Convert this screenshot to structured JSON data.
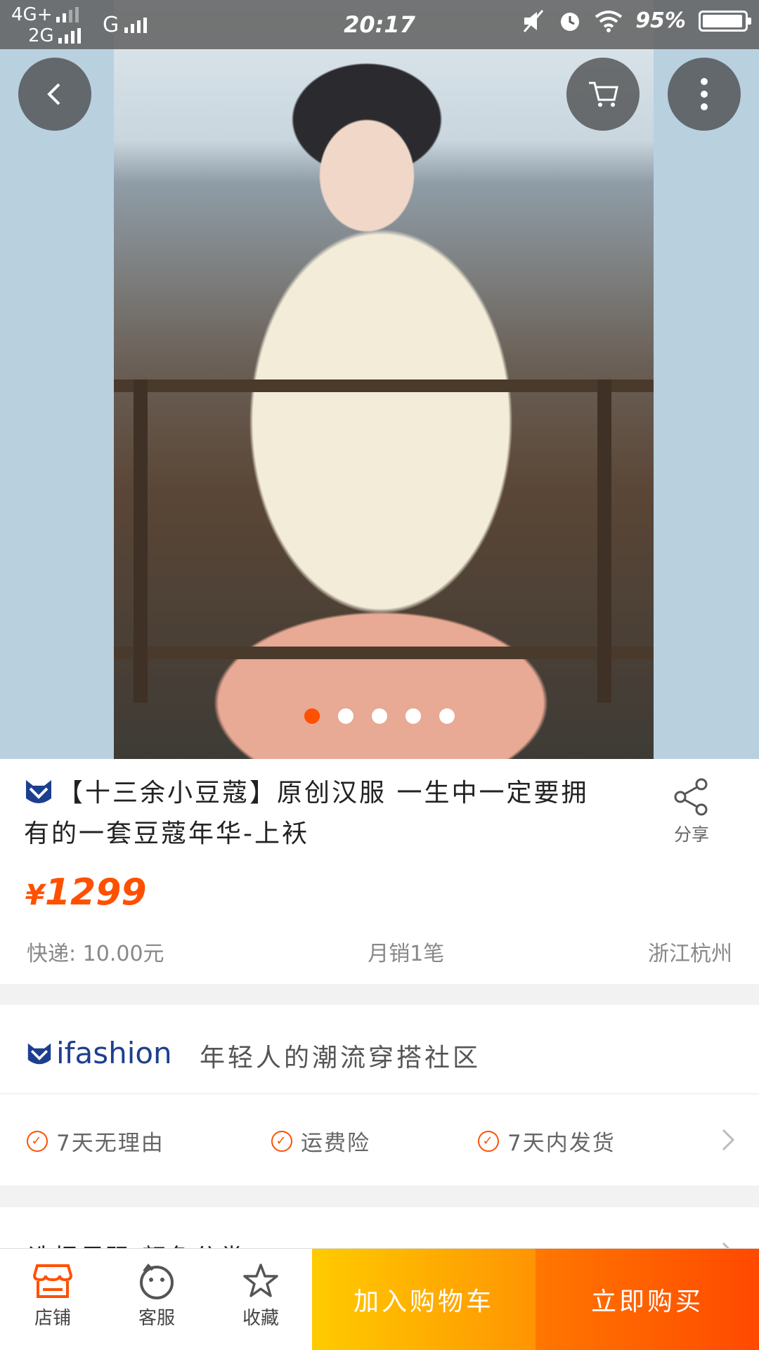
{
  "status_bar": {
    "net1": "4G+",
    "net2": "2G",
    "net3": "G",
    "time": "20:17",
    "battery": "95%",
    "icons": [
      "mute-icon",
      "alarm-icon",
      "wifi-icon",
      "battery-icon"
    ]
  },
  "gallery": {
    "image_count": 5,
    "active_index": 0,
    "colors": {
      "active": "#ff5000",
      "inactive": "#ffffff"
    }
  },
  "product": {
    "title": "【十三余小豆蔻】原创汉服 一生中一定要拥有的一套豆蔻年华-上袄",
    "currency": "¥",
    "price": "1299",
    "shipping": "快递: 10.00元",
    "monthly_sales": "月销1笔",
    "location": "浙江杭州"
  },
  "share": {
    "label": "分享"
  },
  "ifashion": {
    "brand": "ifashion",
    "tagline": "年轻人的潮流穿搭社区"
  },
  "guarantees": [
    {
      "label": "7天无理由"
    },
    {
      "label": "运费险"
    },
    {
      "label": "7天内发货"
    }
  ],
  "select_row": {
    "label": "选择尺码 颜色分类"
  },
  "bottom_bar": {
    "store": "店铺",
    "service": "客服",
    "favorite": "收藏",
    "add_to_cart": "加入购物车",
    "buy_now": "立即购买"
  },
  "colors": {
    "accent": "#ff5000",
    "cart_start": "#ffcb00",
    "cart_end": "#ff9402",
    "buy_start": "#ff7700",
    "buy_end": "#ff4900"
  }
}
